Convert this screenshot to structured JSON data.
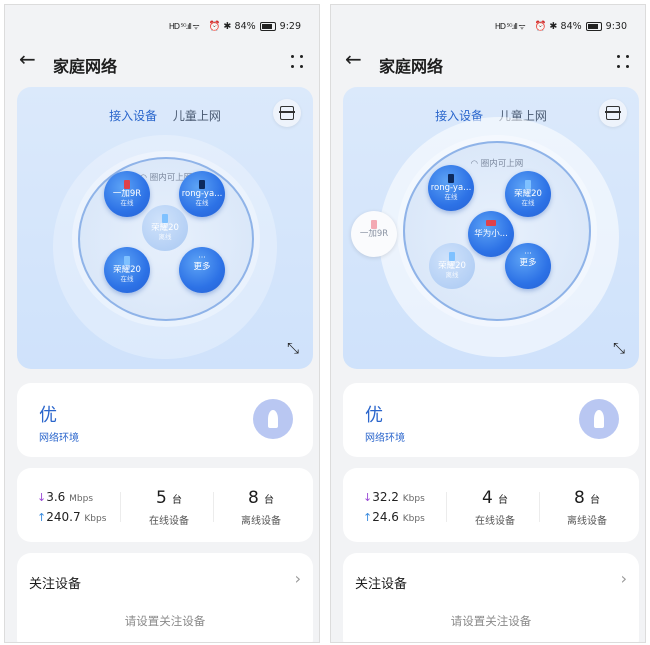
{
  "screens": [
    {
      "status": {
        "left": "HD ⁵ᴳ.ıll ᯤ",
        "right": "⏰ ✱ 84%",
        "time": "9:29"
      },
      "header": {
        "title": "家庭网络"
      },
      "topology": {
        "tabs": [
          "接入设备",
          "儿童上网"
        ],
        "ring_label": "圈内可上网",
        "nodes": [
          {
            "name": "一加9R",
            "state": "在线",
            "icon": "red"
          },
          {
            "name": "rong-ya...",
            "state": "在线",
            "icon": "dark"
          },
          {
            "name": "荣耀20",
            "state": "离线",
            "icon": "blue"
          },
          {
            "name": "荣耀20",
            "state": "在线",
            "icon": "blue"
          },
          {
            "name": "更多",
            "state": "",
            "icon": "dots"
          }
        ]
      },
      "quality": {
        "grade": "优",
        "label": "网络环境"
      },
      "stats": {
        "down_speed": "3.6",
        "down_unit": "Mbps",
        "up_speed": "240.7",
        "up_unit": "Kbps",
        "online_count": "5",
        "online_unit": "台",
        "online_label": "在线设备",
        "offline_count": "8",
        "offline_unit": "台",
        "offline_label": "离线设备"
      },
      "follow": {
        "title": "关注设备",
        "empty": "请设置关注设备"
      }
    },
    {
      "status": {
        "left": "HD ⁵ᴳ.ıll ᯤ",
        "right": "⏰ ✱ 84%",
        "time": "9:30"
      },
      "header": {
        "title": "家庭网络"
      },
      "topology": {
        "tabs": [
          "接入设备",
          "儿童上网"
        ],
        "ring_label": "圈内可上网",
        "outside_node": {
          "name": "一加9R",
          "icon": "pink"
        },
        "nodes": [
          {
            "name": "rong-ya...",
            "state": "在线",
            "icon": "dark"
          },
          {
            "name": "荣耀20",
            "state": "在线",
            "icon": "blue"
          },
          {
            "name": "华为小...",
            "state": "",
            "icon": "red"
          },
          {
            "name": "荣耀20",
            "state": "离线",
            "icon": "blue"
          },
          {
            "name": "更多",
            "state": "",
            "icon": "dots"
          }
        ]
      },
      "quality": {
        "grade": "优",
        "label": "网络环境"
      },
      "stats": {
        "down_speed": "32.2",
        "down_unit": "Kbps",
        "up_speed": "24.6",
        "up_unit": "Kbps",
        "online_count": "4",
        "online_unit": "台",
        "online_label": "在线设备",
        "offline_count": "8",
        "offline_unit": "台",
        "offline_label": "离线设备"
      },
      "follow": {
        "title": "关注设备",
        "empty": "请设置关注设备"
      }
    }
  ]
}
